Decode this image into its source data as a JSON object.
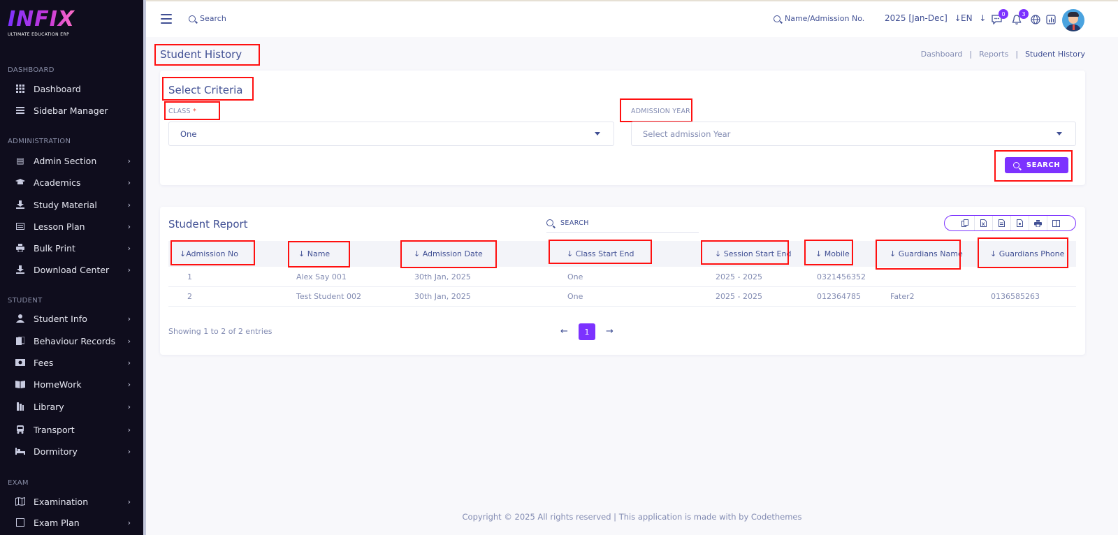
{
  "brand": {
    "logo": "INFIX",
    "tagline": "ULTIMATE EDUCATION ERP"
  },
  "sidebar": {
    "sections": [
      "DASHBOARD",
      "ADMINISTRATION",
      "STUDENT",
      "EXAM"
    ],
    "items": [
      {
        "label": "Dashboard",
        "icon": "grid-icon"
      },
      {
        "label": "Sidebar Manager",
        "icon": "list-icon"
      },
      {
        "label": "Admin Section",
        "icon": "admin-icon"
      },
      {
        "label": "Academics",
        "icon": "graduation-cap-icon"
      },
      {
        "label": "Study Material",
        "icon": "download-icon"
      },
      {
        "label": "Lesson Plan",
        "icon": "lesson-icon"
      },
      {
        "label": "Bulk Print",
        "icon": "printer-icon"
      },
      {
        "label": "Download Center",
        "icon": "download-icon"
      },
      {
        "label": "Student Info",
        "icon": "user-icon"
      },
      {
        "label": "Behaviour Records",
        "icon": "records-icon"
      },
      {
        "label": "Fees",
        "icon": "money-icon"
      },
      {
        "label": "HomeWork",
        "icon": "book-icon"
      },
      {
        "label": "Library",
        "icon": "library-icon"
      },
      {
        "label": "Transport",
        "icon": "bus-icon"
      },
      {
        "label": "Dormitory",
        "icon": "bed-icon"
      },
      {
        "label": "Examination",
        "icon": "map-icon"
      },
      {
        "label": "Exam Plan",
        "icon": "plan-icon"
      }
    ]
  },
  "header": {
    "search_label": "Search",
    "student_search_label": "Name/Admission No.",
    "academic_year": "2025 [Jan-Dec]",
    "language": "EN",
    "messages_count": "0",
    "notifications_count": "3"
  },
  "page": {
    "title": "Student History",
    "breadcrumb": [
      "Dashboard",
      "Reports",
      "Student History"
    ]
  },
  "criteria": {
    "title": "Select Criteria",
    "class_label": "CLASS",
    "class_required": "*",
    "class_value": "One",
    "admission_year_label": "ADMISSION YEAR",
    "admission_year_placeholder": "Select admission Year",
    "search_button": "SEARCH"
  },
  "report": {
    "title": "Student Report",
    "search_placeholder": "SEARCH",
    "columns": [
      "Admission No",
      "Name",
      "Admission Date",
      "Class Start End",
      "Session Start End",
      "Mobile",
      "Guardians Name",
      "Guardians Phone"
    ],
    "rows": [
      [
        "1",
        "Alex Say 001",
        "30th Jan, 2025",
        "One",
        "2025 - 2025",
        "0321456352",
        "",
        ""
      ],
      [
        "2",
        "Test Student 002",
        "30th Jan, 2025",
        "One",
        "2025 - 2025",
        "012364785",
        "Fater2",
        "0136585263"
      ]
    ],
    "showing": "Showing 1 to 2 of 2 entries",
    "current_page": "1"
  },
  "footer": "Copyright © 2025 All rights reserved | This application is made with by Codethemes",
  "colors": {
    "accent": "#7c32ff",
    "text": "#415094",
    "muted": "#828bb2",
    "sidebar_bg": "#0f0d1d",
    "annotation": "#ff1010"
  }
}
